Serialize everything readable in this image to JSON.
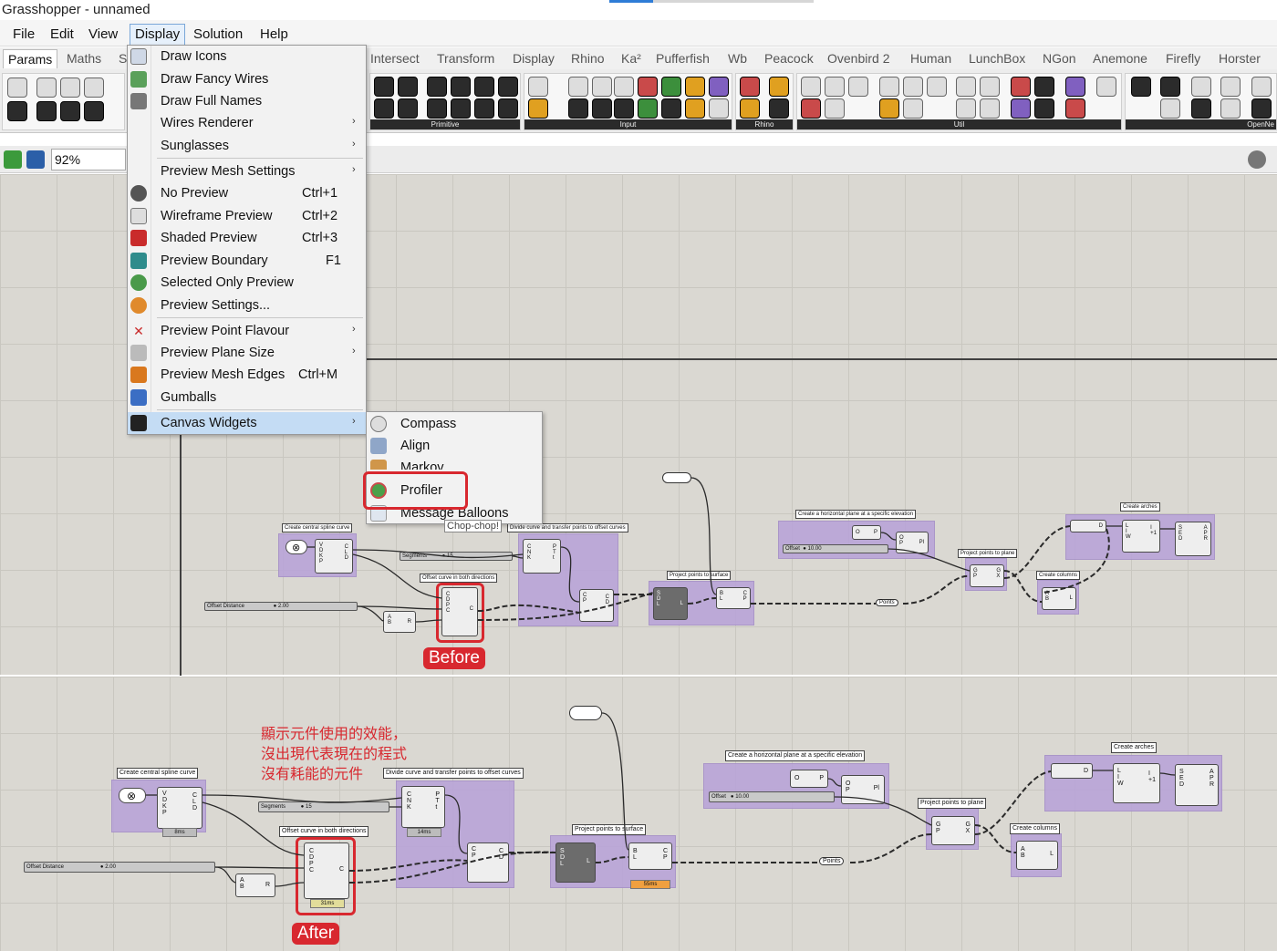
{
  "window": {
    "title": "Grasshopper - unnamed"
  },
  "menubar": {
    "items": [
      "File",
      "Edit",
      "View",
      "Display",
      "Solution",
      "Help"
    ]
  },
  "tabs": [
    "Params",
    "Maths",
    "S",
    "Intersect",
    "Transform",
    "Display",
    "Rhino",
    "Ka²",
    "Pufferfish",
    "Wb",
    "Peacock",
    "Ovenbird 2",
    "Human",
    "LunchBox",
    "NGon",
    "Anemone",
    "Firefly",
    "Horster"
  ],
  "toolbar_groups": [
    "Primitive",
    "Input",
    "Rhino",
    "Util",
    "OpenNe"
  ],
  "zoom": "92%",
  "display_menu": {
    "items": [
      {
        "label": "Draw Icons",
        "shortcut": "",
        "submenu": false
      },
      {
        "label": "Draw Fancy Wires",
        "shortcut": "",
        "submenu": false
      },
      {
        "label": "Draw Full Names",
        "shortcut": "",
        "submenu": false
      },
      {
        "label": "Wires Renderer",
        "shortcut": "",
        "submenu": true
      },
      {
        "label": "Sunglasses",
        "shortcut": "",
        "submenu": true
      },
      {
        "label": "Preview Mesh Settings",
        "shortcut": "",
        "submenu": true
      },
      {
        "label": "No Preview",
        "shortcut": "Ctrl+1",
        "submenu": false
      },
      {
        "label": "Wireframe Preview",
        "shortcut": "Ctrl+2",
        "submenu": false
      },
      {
        "label": "Shaded Preview",
        "shortcut": "Ctrl+3",
        "submenu": false
      },
      {
        "label": "Preview Boundary",
        "shortcut": "F1",
        "submenu": false
      },
      {
        "label": "Selected Only Preview",
        "shortcut": "",
        "submenu": false
      },
      {
        "label": "Preview Settings...",
        "shortcut": "",
        "submenu": false
      },
      {
        "label": "Preview Point Flavour",
        "shortcut": "",
        "submenu": true
      },
      {
        "label": "Preview Plane Size",
        "shortcut": "",
        "submenu": true
      },
      {
        "label": "Preview Mesh Edges",
        "shortcut": "Ctrl+M",
        "submenu": false
      },
      {
        "label": "Gumballs",
        "shortcut": "",
        "submenu": false
      },
      {
        "label": "Canvas Widgets",
        "shortcut": "",
        "submenu": true
      }
    ]
  },
  "canvas_widgets_menu": {
    "items": [
      "Compass",
      "Align",
      "Markov",
      "Profiler",
      "Message Balloons"
    ],
    "tooltip": "Chop-chop!"
  },
  "canvas": {
    "groups": {
      "central": "Create central spline curve",
      "divide": "Divide curve and transfer points to offset curves",
      "offset": "Offset curve in both directions",
      "project_surface": "Project  points to surface",
      "hplane": "Create a horizontal plane at a specific elevation",
      "project_plane": "Project points to plane",
      "arches": "Create arches",
      "columns": "Create columns"
    },
    "sliders": {
      "segments_label": "Segments",
      "segments_value": "15",
      "offset_dist_label": "Offset Distance",
      "offset_dist_value": "2.00",
      "offset_label": "Offset",
      "offset_value": "10.00"
    },
    "points_label": "Points",
    "pins": {
      "spline_in": "V\nD\nK\nP",
      "spline_out": "C\nL\nD",
      "divide_in": "C\nN\nK",
      "divide_out": "P\nT\nt",
      "offset_in": "C\nD\nP\nC",
      "offset_out": "C",
      "sr_in": "C\nP",
      "sr_out": "C\nD",
      "proj_in": "S\nD\nL",
      "proj_out": "L",
      "projb_in": "B\nL",
      "projb_out": "C\nP",
      "pl_in": "O\nP",
      "pl_out": "Pl",
      "xyz_in": "O",
      "xyz_out": "P",
      "pp_in": "G\nP",
      "pp_out": "G\nX",
      "arch1_in": "L\nI\nW",
      "arch1_out": "I\n+1",
      "arch2_in": "S\nE\nD",
      "arch2_out": "A\nP\nR",
      "col_in": "A\nB",
      "col_out": "L",
      "d_out": "D",
      "ab_in": "A\nB",
      "ab_out": "R"
    },
    "timings": {
      "spline": "8ms",
      "divide": "14ms",
      "offset": "31ms",
      "project": "55ms"
    }
  },
  "annotations": {
    "before": "Before",
    "after": "After",
    "note_lines": [
      "顯示元件使用的效能，",
      "沒出現代表現在的程式",
      "沒有耗能的元件"
    ]
  },
  "colors": {
    "accent_red": "#d8282f",
    "group_purple": "#b9a4d8",
    "menu_highlight": "#c4dcf4"
  }
}
